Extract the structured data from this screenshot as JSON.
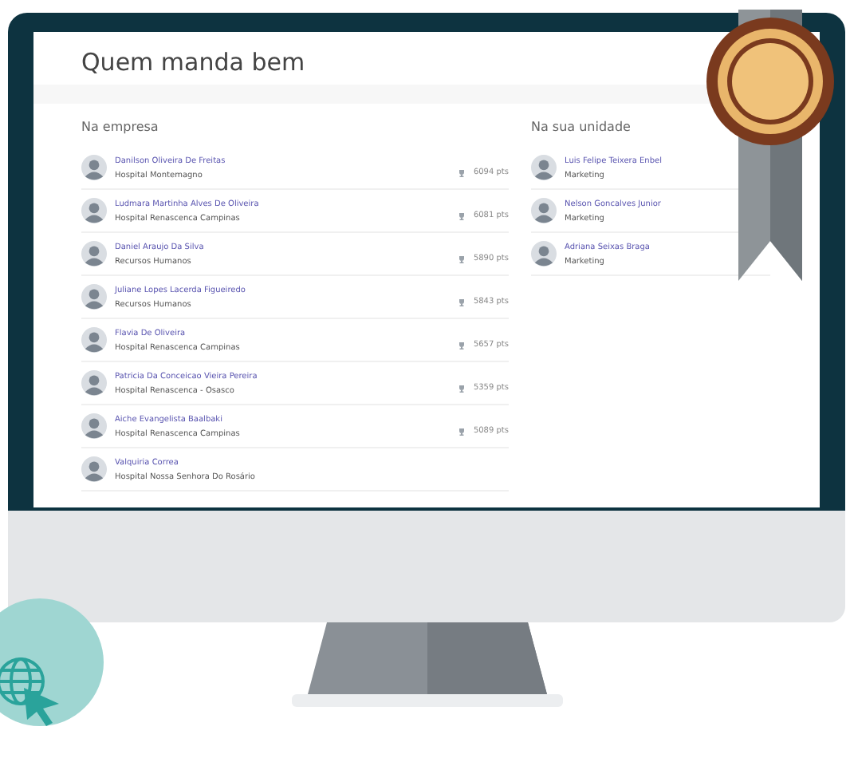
{
  "title": "Quem manda bem",
  "company": {
    "heading": "Na empresa",
    "rows": [
      {
        "name": "Danilson Oliveira De Freitas",
        "unit": "Hospital Montemagno",
        "points": "6094 pts"
      },
      {
        "name": "Ludmara Martinha Alves De Oliveira",
        "unit": "Hospital Renascenca Campinas",
        "points": "6081 pts"
      },
      {
        "name": "Daniel Araujo Da Silva",
        "unit": "Recursos Humanos",
        "points": "5890 pts"
      },
      {
        "name": "Juliane Lopes Lacerda Figueiredo",
        "unit": "Recursos Humanos",
        "points": "5843 pts"
      },
      {
        "name": "Flavia De Oliveira",
        "unit": "Hospital Renascenca Campinas",
        "points": "5657 pts"
      },
      {
        "name": "Patricia Da Conceicao Vieira Pereira",
        "unit": "Hospital Renascenca - Osasco",
        "points": "5359 pts"
      },
      {
        "name": "Aiche Evangelista Baalbaki",
        "unit": "Hospital Renascenca Campinas",
        "points": "5089 pts"
      },
      {
        "name": "Valquiria Correa",
        "unit": "Hospital Nossa Senhora Do Rosário"
      }
    ]
  },
  "unit": {
    "heading": "Na sua unidade",
    "rows": [
      {
        "name": "Luis Felipe Teixera Enbel",
        "unit": "Marketing"
      },
      {
        "name": "Nelson Goncalves Junior",
        "unit": "Marketing"
      },
      {
        "name": "Adriana Seixas Braga",
        "unit": "Marketing"
      }
    ]
  }
}
